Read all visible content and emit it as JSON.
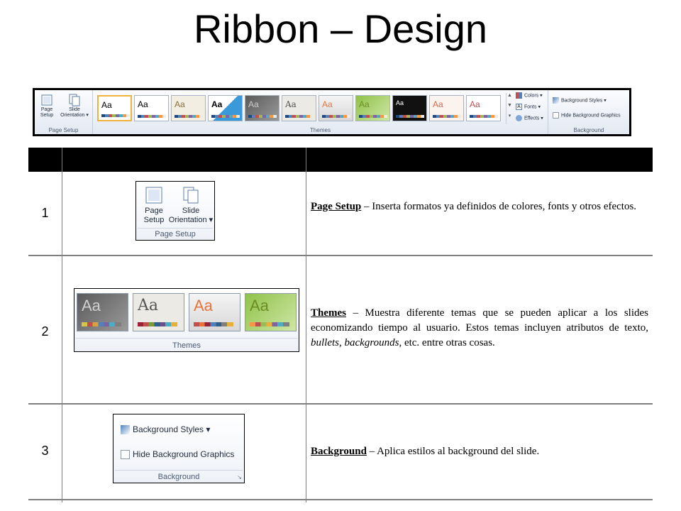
{
  "title": "Ribbon – Design",
  "ribbon": {
    "page_setup_group": {
      "label": "Page Setup",
      "page_setup_btn": "Page Setup",
      "page_setup_line1": "Page",
      "page_setup_line2": "Setup",
      "slide_orientation_line1": "Slide",
      "slide_orientation_line2": "Orientation ▾"
    },
    "themes_group": {
      "label": "Themes",
      "thumb_text": "Aa"
    },
    "tools": {
      "colors": "Colors ▾",
      "fonts": "Fonts ▾",
      "effects": "Effects ▾"
    },
    "background_group": {
      "label": "Background",
      "styles": "Background Styles ▾",
      "hide": "Hide Background Graphics"
    }
  },
  "rows": [
    {
      "number": "1",
      "key": "Page Setup",
      "text": " – Inserta formatos ya definidos de colores, fonts y otros efectos.",
      "panel_label": "Page Setup",
      "btn1_line1": "Page",
      "btn1_line2": "Setup",
      "btn2_line1": "Slide",
      "btn2_line2": "Orientation ▾"
    },
    {
      "number": "2",
      "key": "Themes",
      "text_a": " – Muestra diferente temas que se pueden aplicar a los slides economizando tiempo al usuario.  Estos temas incluyen atributos de texto, ",
      "text_bullets": "bullets",
      "text_comma": ", ",
      "text_backgrounds": "backgrounds",
      "text_b": ", etc. entre otras cosas.",
      "panel_label": "Themes",
      "thumb_text": "Aa"
    },
    {
      "number": "3",
      "key": "Background",
      "text": " – Aplica estilos al background del slide.",
      "panel_label": "Background",
      "styles": "Background Styles ▾",
      "hide": "Hide Background Graphics"
    }
  ],
  "colors": {
    "header_bg": "#000000",
    "theme_blue": "#1f497d",
    "theme_orange": "#f79646",
    "theme_green": "#9bbb59",
    "theme_gray": "#7f7f7f"
  }
}
